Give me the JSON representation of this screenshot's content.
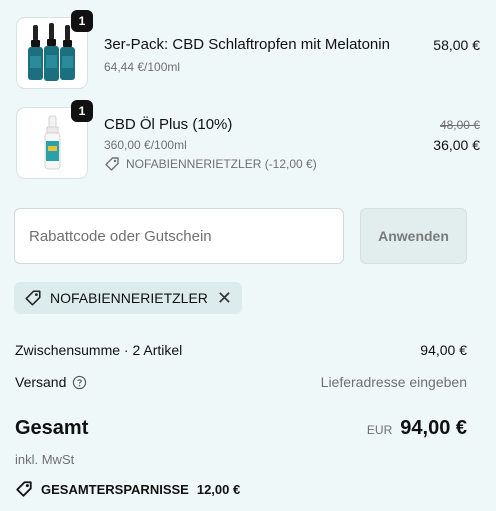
{
  "items": [
    {
      "quantity": "1",
      "name": "3er-Pack: CBD Schlaftropfen mit Melatonin",
      "unit_price": "64,44 €/100ml",
      "price": "58,00 €"
    },
    {
      "quantity": "1",
      "name": "CBD Öl Plus (10%)",
      "unit_price": "360,00 €/100ml",
      "discount": "NOFABIENNERIETZLER (-12,00 €)",
      "original_price": "48,00 €",
      "price": "36,00 €"
    }
  ],
  "discount_form": {
    "placeholder": "Rabattcode oder Gutschein",
    "apply_label": "Anwenden"
  },
  "applied_code": {
    "label": "NOFABIENNERIETZLER",
    "remove_symbol": "✕"
  },
  "summary": {
    "subtotal_label": "Zwischensumme · 2 Artikel",
    "subtotal_value": "94,00 €",
    "shipping_label": "Versand",
    "shipping_value": "Lieferadresse eingeben",
    "total_label": "Gesamt",
    "currency": "EUR",
    "total_value": "94,00 €",
    "tax_note": "inkl. MwSt",
    "savings_label": "GESAMTERSPARNISSE",
    "savings_value": "12,00 €"
  },
  "colors": {
    "background": "#eef8f8",
    "bottle_teal": "#1c6f7e",
    "dropper_dark": "#222222"
  },
  "icons": [
    "tag-icon",
    "help-circle-icon",
    "remove-icon"
  ]
}
